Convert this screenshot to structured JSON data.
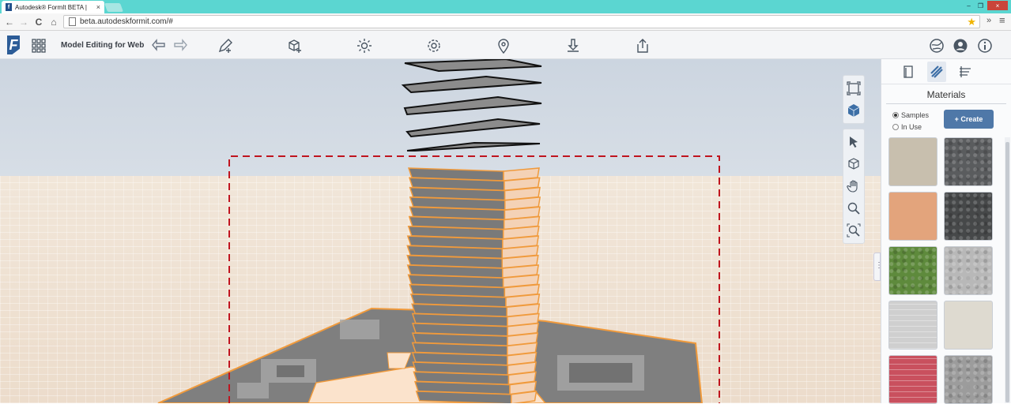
{
  "browser": {
    "tab_title": "Autodesk® FormIt BETA |",
    "tab_close": "×",
    "url": "beta.autodeskformit.com/#",
    "back": "←",
    "forward": "→",
    "reload": "C",
    "home": "⌂",
    "star": "★",
    "more_ext": "»",
    "menu": "≡",
    "win_min": "–",
    "win_max": "❐",
    "win_close": "×"
  },
  "app": {
    "logo": "F",
    "title": "Model Editing for Web"
  },
  "panel": {
    "title": "Materials",
    "radio_samples": "Samples",
    "radio_in_use": "In Use",
    "selected": "Samples",
    "create_label": "+ Create",
    "swatches": [
      {
        "name": "beige-stucco",
        "color": "#c8bfae"
      },
      {
        "name": "dark-granite",
        "color": "#5a5c5e"
      },
      {
        "name": "terracotta",
        "color": "#e3a47c"
      },
      {
        "name": "charcoal-stone",
        "color": "#464849"
      },
      {
        "name": "grass",
        "color": "#5e8a3c"
      },
      {
        "name": "grey-stone-wall",
        "color": "#b8b8b8"
      },
      {
        "name": "light-grey-brick",
        "color": "#cfcfcf"
      },
      {
        "name": "cream-plaster",
        "color": "#dedad0"
      },
      {
        "name": "red-brick",
        "color": "#c9505e"
      },
      {
        "name": "gravel",
        "color": "#9c9c9c"
      }
    ]
  },
  "colors": {
    "accent": "#4f78a8",
    "selection": "#f09a3c",
    "dashed_box": "#c0141e"
  }
}
